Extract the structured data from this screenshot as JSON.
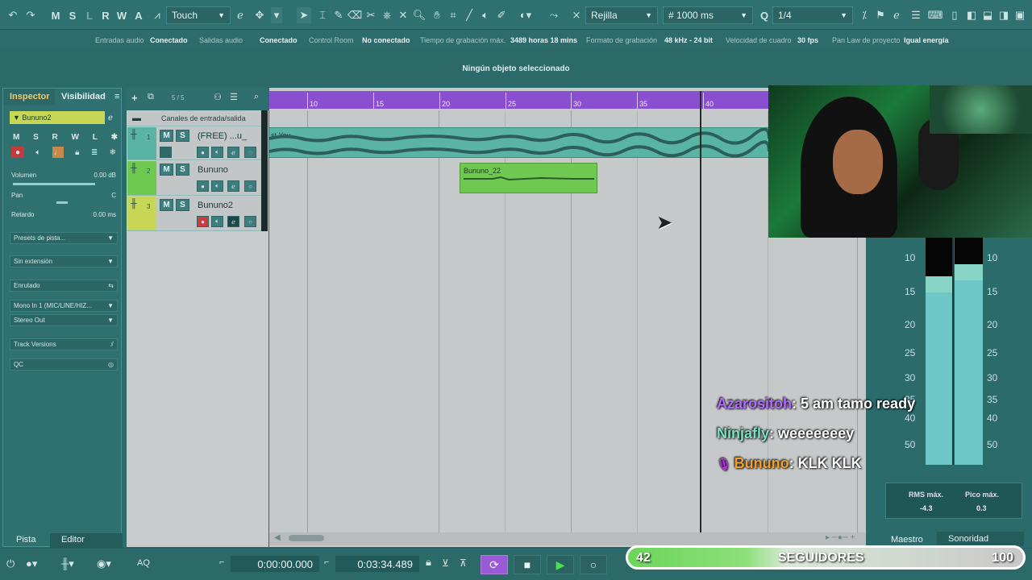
{
  "toolbar": {
    "letters": [
      "M",
      "S",
      "L",
      "R",
      "W",
      "A"
    ],
    "automation_mode": "Touch",
    "snap_type": "Rejilla",
    "snap_value": "1000 ms",
    "quantize": "1/4"
  },
  "status": {
    "items": [
      {
        "label": "Entradas audio",
        "value": "Conectado"
      },
      {
        "label": "Salidas audio",
        "value": "Conectado"
      },
      {
        "label": "Control Room",
        "value": "No conectado"
      },
      {
        "label": "Tiempo de grabación máx.",
        "value": "3489 horas 18 mins"
      },
      {
        "label": "Formato de grabación",
        "value": "48 kHz - 24 bit"
      },
      {
        "label": "Velocidad de cuadro",
        "value": "30 fps"
      },
      {
        "label": "Pan Law de proyecto",
        "value": "Igual energía"
      }
    ]
  },
  "info_message": "Ningún objeto seleccionado",
  "inspector": {
    "tab_inspector": "Inspector",
    "tab_visibility": "Visibilidad",
    "track_name": "Bununo2",
    "buttons": [
      "M",
      "S",
      "R",
      "W",
      "L"
    ],
    "volume_label": "Volumen",
    "volume_value": "0.00 dB",
    "pan_label": "Pan",
    "pan_value": "C",
    "delay_label": "Retardo",
    "delay_value": "0.00 ms",
    "presets": "Presets de pista...",
    "extension": "Sin extensión",
    "routing": "Enrutado",
    "input": "Mono In 1 (MIC/LINE/HIZ...",
    "output": "Stereo Out",
    "track_versions": "Track Versions",
    "qc": "QC",
    "bottom_tab1": "Pista",
    "bottom_tab2": "Editor"
  },
  "tracklist": {
    "count": "5 / 5",
    "folder": "Canales de entrada/salida",
    "tracks": [
      {
        "num": "1",
        "name": "(FREE) ...u_",
        "color": "#5ab4a4"
      },
      {
        "num": "2",
        "name": "Bununo",
        "color": "#6fc850"
      },
      {
        "num": "3",
        "name": "Bununo2",
        "color": "#c7d655"
      }
    ]
  },
  "ruler": {
    "labels": [
      "10",
      "15",
      "20",
      "25",
      "30",
      "35",
      "40"
    ]
  },
  "events": {
    "audio1_label": "st You",
    "audio2_label": "Bununo_22"
  },
  "meter": {
    "scale_left": [
      "10",
      "15",
      "20",
      "25",
      "30",
      "35",
      "40",
      "50"
    ],
    "scale_right": [
      "10",
      "15",
      "20",
      "25",
      "30",
      "35",
      "40",
      "50"
    ],
    "rms_label": "RMS máx.",
    "rms_value": "-4.3",
    "peak_label": "Pico máx.",
    "peak_value": "0.3",
    "tab_master": "Maestro",
    "tab_loudness": "Sonoridad"
  },
  "chat": [
    {
      "user": "Azarositoh",
      "message": ": 5 am tamo ready",
      "color": "#b36bff"
    },
    {
      "user": "Ninjafly",
      "message": ": weeeeeeey",
      "color": "#7ee0c0"
    },
    {
      "user": "Bununo",
      "message": ": KLK KLK",
      "color": "#f0a030"
    }
  ],
  "transport": {
    "left_time": "0:00:00.000",
    "right_time": "0:03:34.489",
    "aq_label": "AQ"
  },
  "followers": {
    "current": "42",
    "label": "SEGUIDORES",
    "goal": "100"
  }
}
